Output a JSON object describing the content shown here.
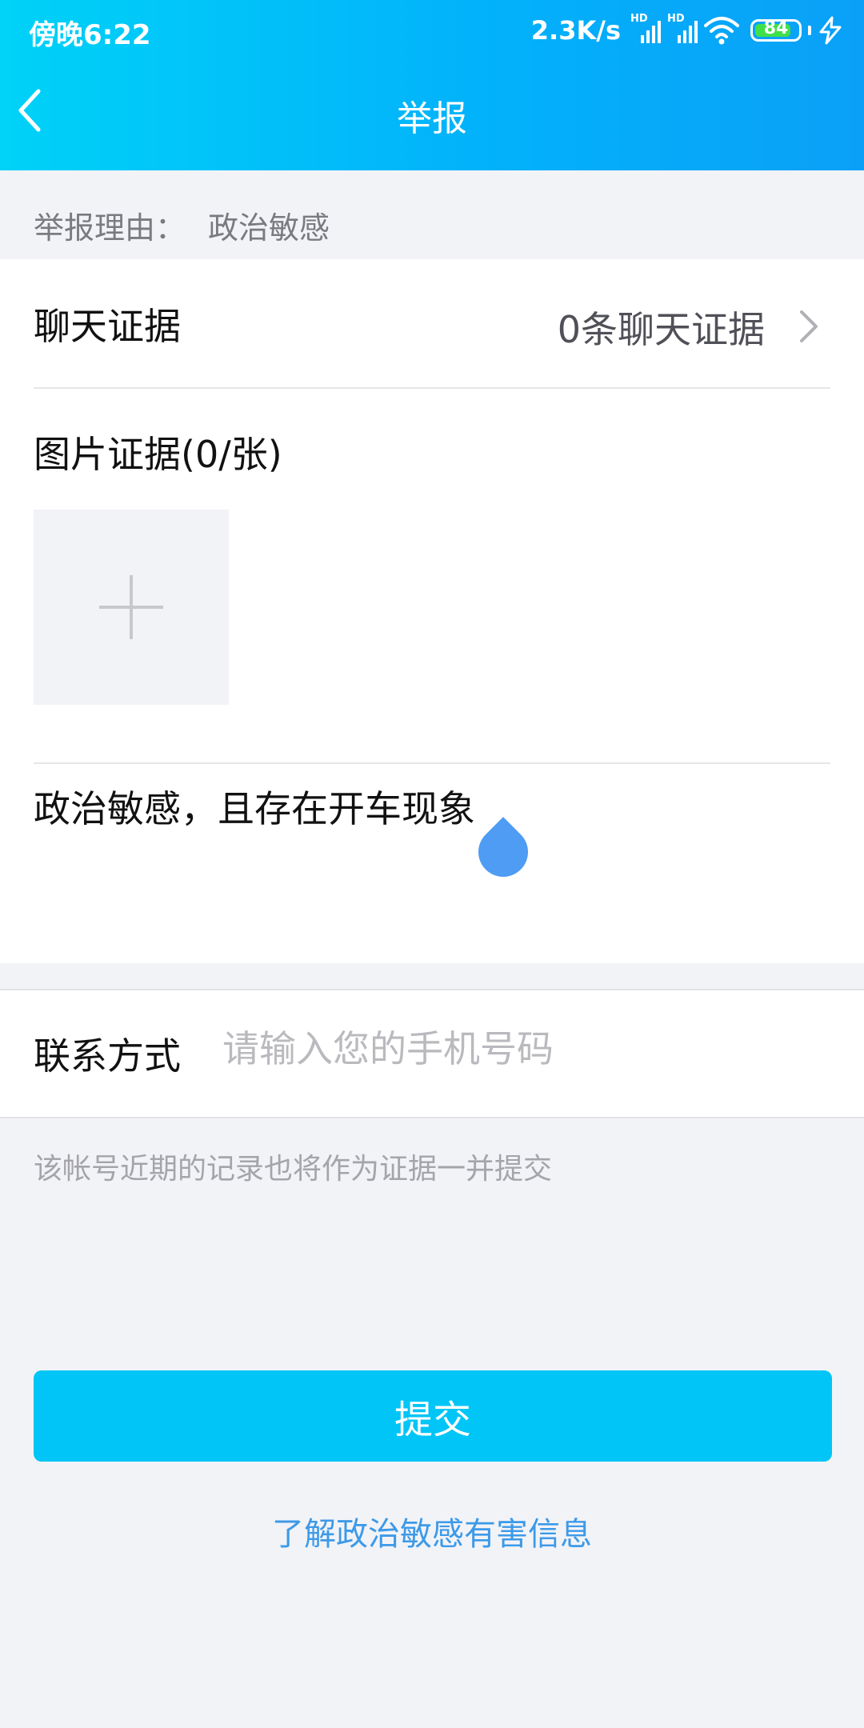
{
  "status_bar": {
    "time": "傍晚6:22",
    "net_speed": "2.3K/s",
    "signal_tag_1": "HD",
    "signal_tag_2": "HD",
    "battery_percent": "84",
    "battery_level": 0.84,
    "icons": [
      "signal-icon",
      "signal-icon",
      "wifi-icon",
      "battery-icon",
      "charging-icon"
    ]
  },
  "header": {
    "title": "举报",
    "back_icon": "chevron-left-icon",
    "background_colors": [
      "#00d2f8",
      "#0aa0f8"
    ]
  },
  "reason": {
    "label": "举报理由：",
    "value": "政治敏感"
  },
  "chat_evidence": {
    "label": "聊天证据",
    "value": "0条聊天证据",
    "icon": "chevron-right-icon"
  },
  "image_evidence": {
    "label": "图片证据(0/张)",
    "add_icon": "plus-icon"
  },
  "description": {
    "text": "政治敏感，且存在开车现象"
  },
  "contact": {
    "label": "联系方式",
    "placeholder": "请输入您的手机号码"
  },
  "note": "该帐号近期的记录也将作为证据一并提交",
  "submit": {
    "label": "提交",
    "color": "#01c5f7"
  },
  "learn_more": "了解政治敏感有害信息"
}
